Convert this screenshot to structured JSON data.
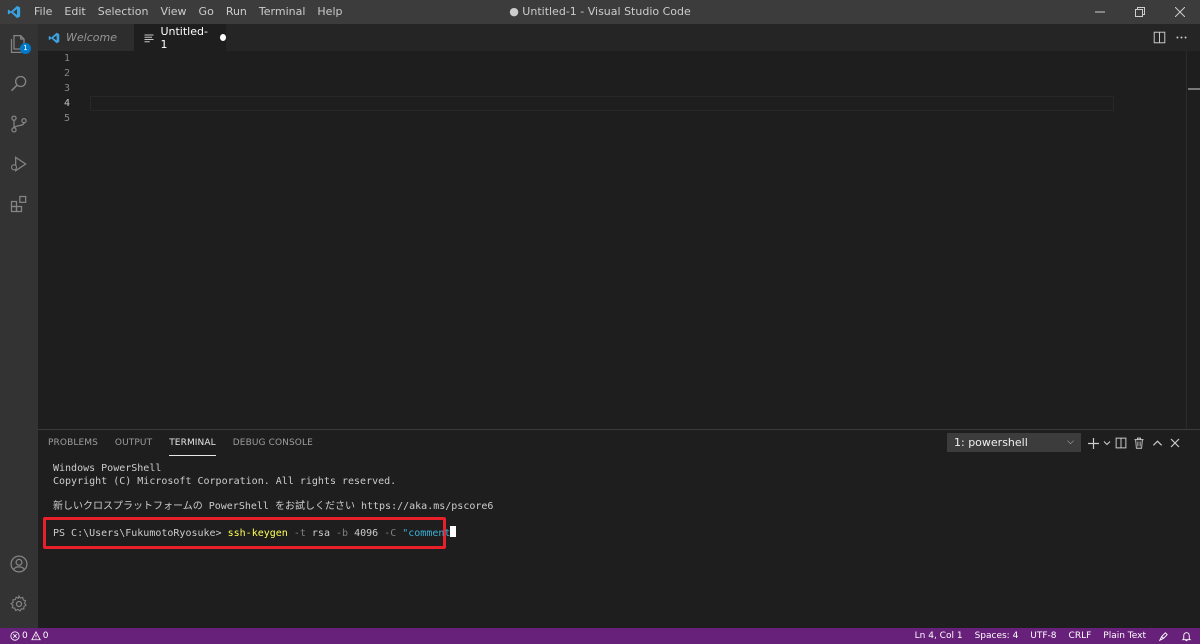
{
  "window": {
    "title": "● Untitled-1 - Visual Studio Code"
  },
  "menu": [
    "File",
    "Edit",
    "Selection",
    "View",
    "Go",
    "Run",
    "Terminal",
    "Help"
  ],
  "activity_bar": {
    "explorer_badge": "1"
  },
  "tabs": [
    {
      "label": "Welcome",
      "italic": true
    },
    {
      "label": "Untitled-1",
      "dirty": true
    }
  ],
  "editor": {
    "line_numbers": [
      "1",
      "2",
      "3",
      "4",
      "5"
    ],
    "active_line": "4"
  },
  "panel": {
    "tabs": [
      "PROBLEMS",
      "OUTPUT",
      "TERMINAL",
      "DEBUG CONSOLE"
    ],
    "active_tab": "TERMINAL",
    "terminal_selector": "1: powershell",
    "terminal_lines": [
      "Windows PowerShell",
      "Copyright (C) Microsoft Corporation. All rights reserved.",
      "",
      "新しいクロスプラットフォームの PowerShell をお試しください https://aka.ms/pscore6"
    ],
    "command": {
      "prompt": "PS C:\\Users\\FukumotoRyosuke> ",
      "cmd": "ssh-keygen",
      "p1": " -t",
      "a1": " rsa",
      "p2": " -b",
      "a2": " 4096",
      "p3": " -C",
      "str": " \"comment"
    }
  },
  "status_bar": {
    "errors": "0",
    "warnings": "0",
    "position": "Ln 4, Col 1",
    "spaces": "Spaces: 4",
    "encoding": "UTF-8",
    "eol": "CRLF",
    "language": "Plain Text"
  },
  "colors": {
    "statusbar": "#68217a",
    "highlight_box": "#e8202a",
    "accent": "#007acc"
  }
}
